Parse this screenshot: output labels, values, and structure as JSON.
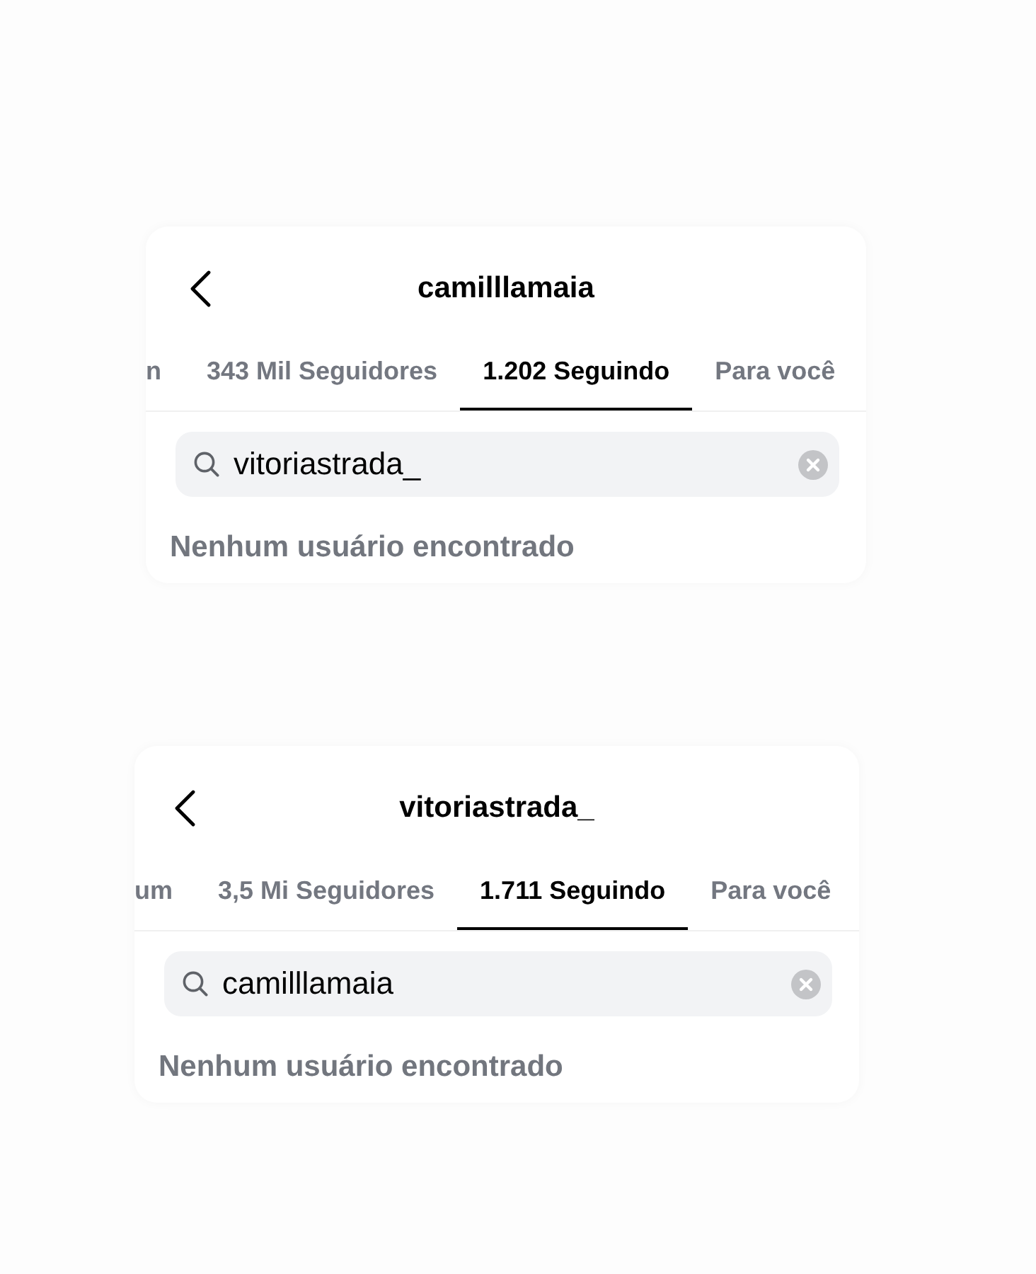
{
  "screens": [
    {
      "title": "camilllamaia",
      "tabs": [
        {
          "label": "n",
          "selected": false
        },
        {
          "label": "343 Mil Seguidores",
          "selected": false
        },
        {
          "label": "1.202 Seguindo",
          "selected": true
        },
        {
          "label": "Para você",
          "selected": false
        }
      ],
      "search": {
        "value": "vitoriastrada_"
      },
      "message": "Nenhum usuário encontrado"
    },
    {
      "title": "vitoriastrada_",
      "tabs": [
        {
          "label": "um",
          "selected": false
        },
        {
          "label": "3,5 Mi Seguidores",
          "selected": false
        },
        {
          "label": "1.711 Seguindo",
          "selected": true
        },
        {
          "label": "Para você",
          "selected": false
        }
      ],
      "search": {
        "value": "camilllamaia"
      },
      "message": "Nenhum usuário encontrado"
    }
  ]
}
